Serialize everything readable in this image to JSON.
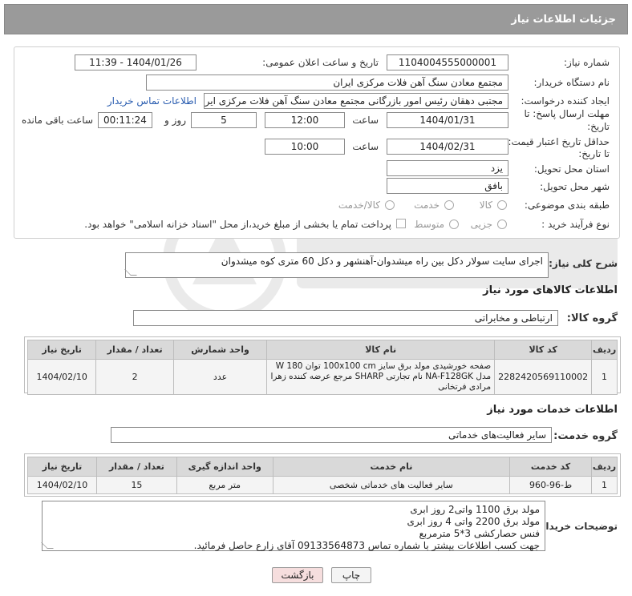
{
  "header": {
    "title": "جزئیات اطلاعات نیاز"
  },
  "form": {
    "need_number_label": "شماره نیاز:",
    "need_number": "1104004555000001",
    "announce_label": "تاریخ و ساعت اعلان عمومی:",
    "announce_value": "1404/01/26 - 11:39",
    "buyer_label": "نام دستگاه خریدار:",
    "buyer_value": "مجتمع معادن سنگ آهن فلات مرکزی ایران",
    "creator_label": "ایجاد کننده درخواست:",
    "creator_value": "مجتبی  دهقان رئیس امور بازرگانی مجتمع معادن سنگ آهن فلات مرکزی ایران",
    "contact_link": "اطلاعات تماس خریدار",
    "deadline_label_1": "مهلت ارسال پاسخ: تا",
    "deadline_label_2": "تاریخ:",
    "deadline_date": "1404/01/31",
    "hour_label": "ساعت",
    "deadline_time": "12:00",
    "days_value": "5",
    "days_label": "روز و",
    "remaining_time": "00:11:24",
    "remaining_label": "ساعت باقی مانده",
    "validity_label_1": "حداقل تاریخ اعتبار قیمت:",
    "validity_label_2": "تا تاریخ:",
    "validity_date": "1404/02/31",
    "validity_time": "10:00",
    "province_label": "استان محل تحویل:",
    "province_value": "یزد",
    "city_label": "شهر محل تحویل:",
    "city_value": "بافق",
    "category_label": "طبقه بندی موضوعی:",
    "category_options": [
      "کالا",
      "خدمت",
      "کالا/خدمت"
    ],
    "process_label": "نوع فرآیند خرید :",
    "process_options": [
      "جزیی",
      "متوسط"
    ],
    "payment_note": "پرداخت تمام یا بخشی از مبلغ خرید،از محل \"اسناد خزانه اسلامی\" خواهد بود."
  },
  "description": {
    "label": "شرح کلی نیاز:",
    "value": "اجرای سایت سولار دکل بین راه میشدوان-آهنشهر و دکل 60 متری کوه میشدوان"
  },
  "goods": {
    "section_title": "اطلاعات کالاهای مورد نیاز",
    "group_label": "گروه کالا:",
    "group_value": "ارتباطی و مخابراتی",
    "columns": [
      "ردیف",
      "کد کالا",
      "نام کالا",
      "واحد شمارش",
      "تعداد / مقدار",
      "تاریخ نیاز"
    ],
    "rows": [
      {
        "row": "1",
        "code": "2282420569110002",
        "name": "صفحه خورشیدی مولد برق سایز 100x100 cm توان 180 W مدل NA-F128GK نام تجارتی SHARP مرجع عرضه کننده زهرا مرادی فرتخانی",
        "unit": "عدد",
        "qty": "2",
        "date": "1404/02/10"
      }
    ]
  },
  "services": {
    "section_title": "اطلاعات خدمات مورد نیاز",
    "group_label": "گروه خدمت:",
    "group_value": "سایر فعالیت‌های خدماتی",
    "columns": [
      "ردیف",
      "کد خدمت",
      "نام خدمت",
      "واحد اندازه گیری",
      "تعداد / مقدار",
      "تاریخ نیاز"
    ],
    "rows": [
      {
        "row": "1",
        "code": "ط-96-960",
        "name": "سایر فعالیت های خدماتی شخصی",
        "unit": "متر مربع",
        "qty": "15",
        "date": "1404/02/10"
      }
    ]
  },
  "buyer_notes": {
    "label": "توضیحات خریدار:",
    "lines": [
      "مولد برق 1100 واتی2 روز ابری",
      "مولد برق 2200 واتی 4 روز ابری",
      "فنس حصارکشی 3*5 مترمربع",
      "جهت کسب اطلاعات بیشتر با شماره تماس 09133564873 آقای زارع حاصل فرمائید."
    ]
  },
  "buttons": {
    "print": "چاپ",
    "back": "بازگشت"
  },
  "colors": {
    "header_bg": "#9a9a9a",
    "link": "#2a5db0",
    "table_header": "#d9d9d9",
    "back_button_bg": "#f6dede"
  }
}
